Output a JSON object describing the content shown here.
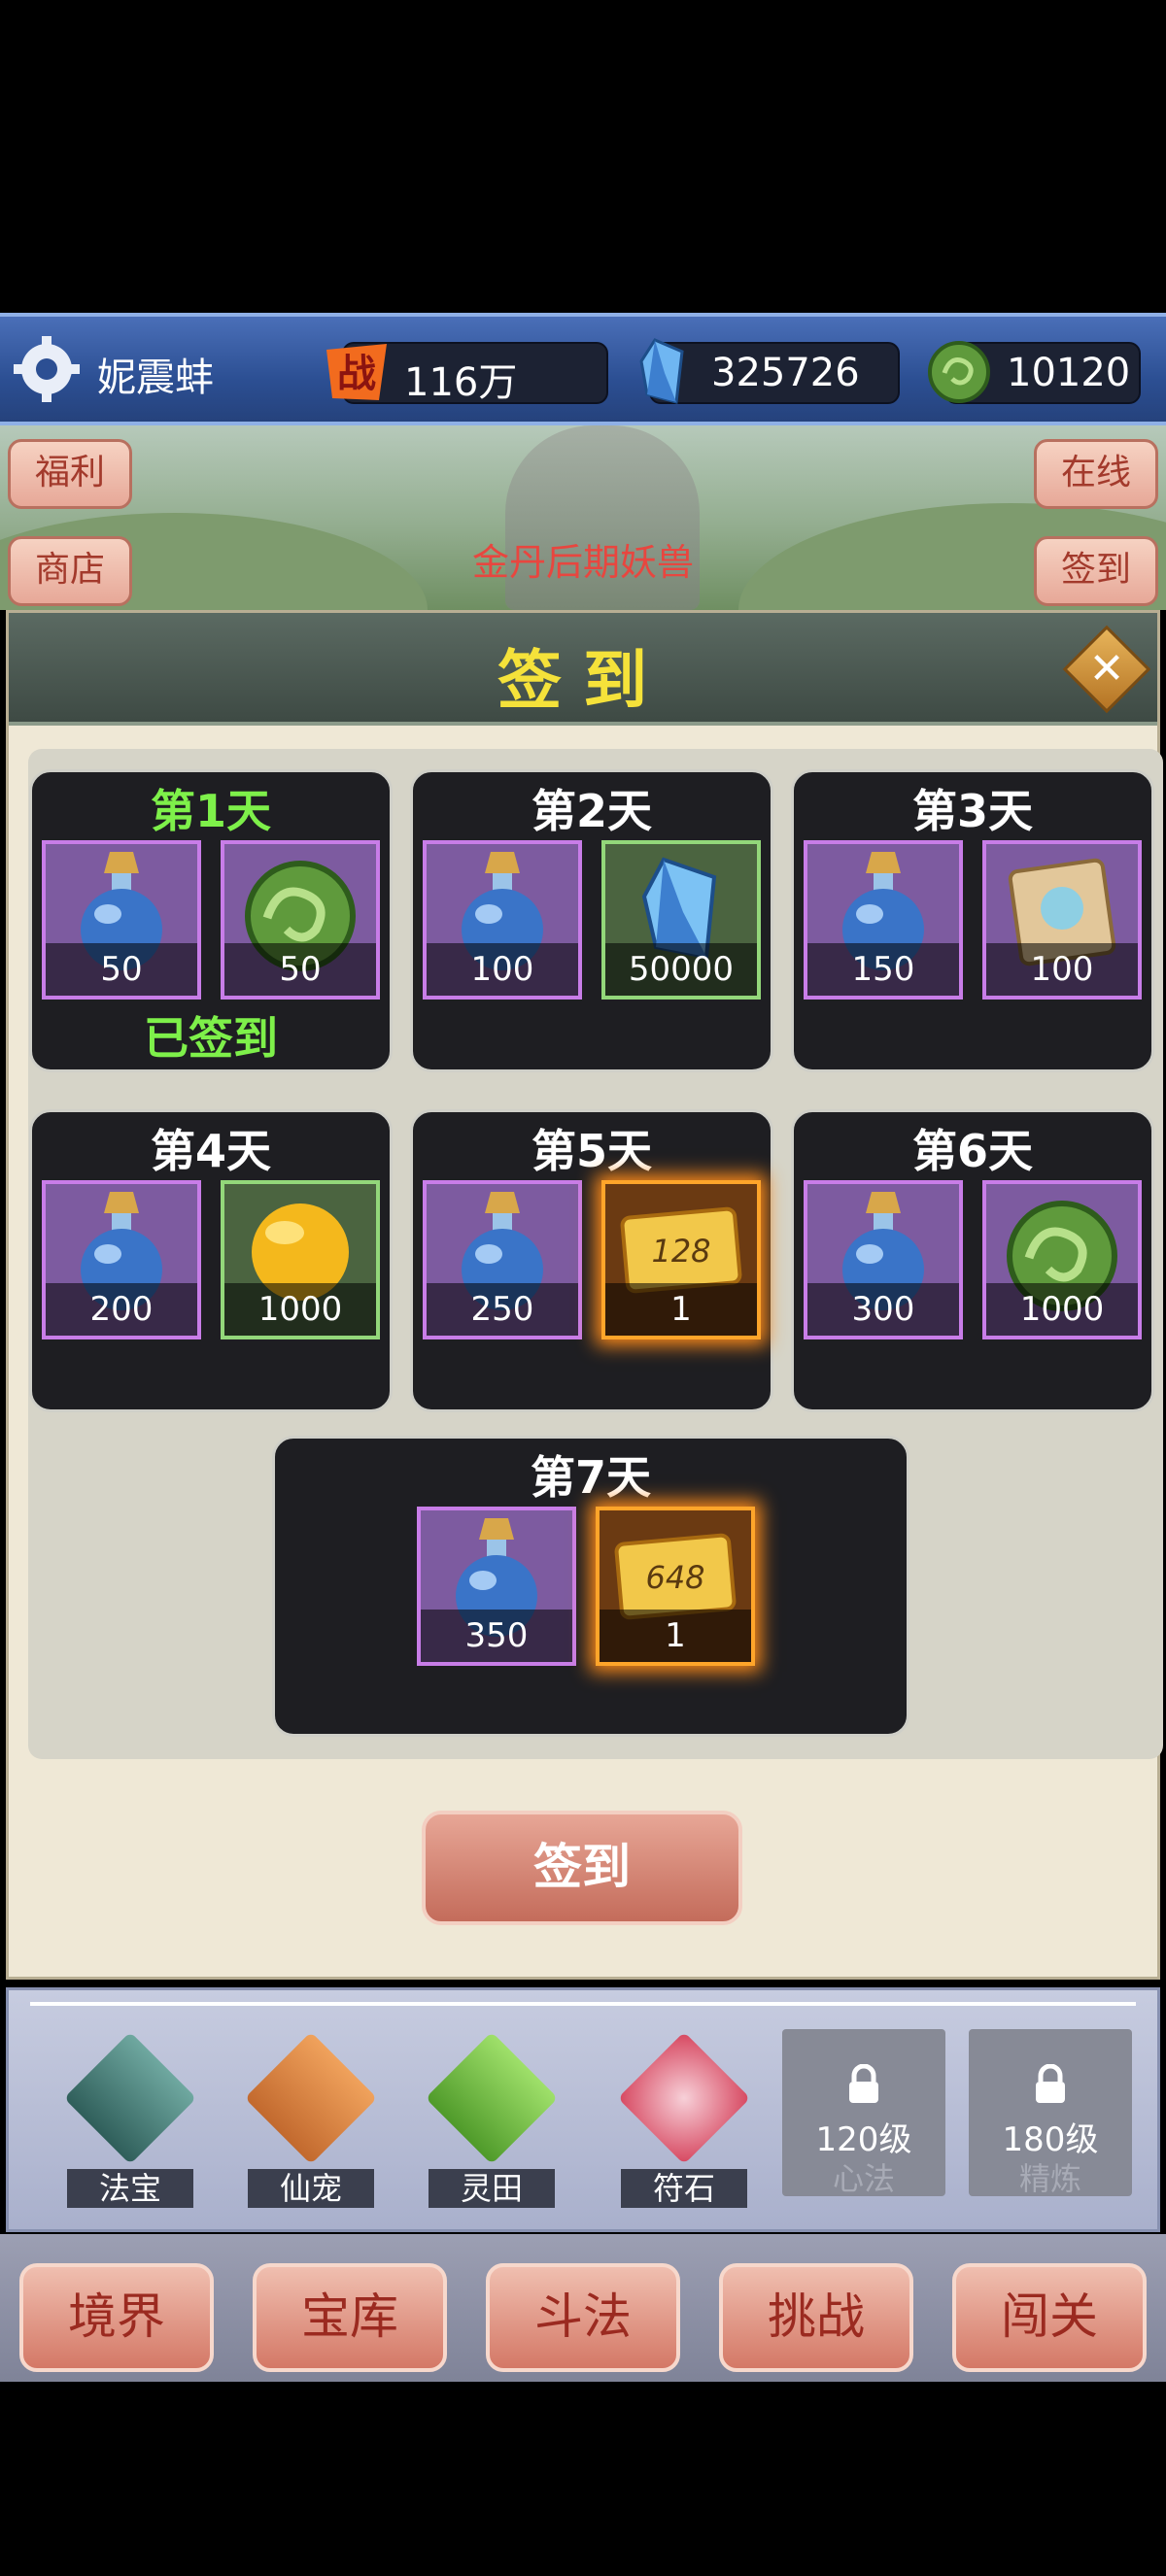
{
  "player": {
    "name": "妮震蚌",
    "gear_icon": "gear-icon"
  },
  "resources": [
    {
      "icon": "battle-power-icon",
      "icon_text": "战",
      "value": "116万"
    },
    {
      "icon": "crystal-icon",
      "value": "325726"
    },
    {
      "icon": "jade-coin-icon",
      "value": "10120"
    }
  ],
  "side_buttons": {
    "left": [
      "福利",
      "商店"
    ],
    "right": [
      "在线",
      "签到"
    ]
  },
  "scene_label": "金丹后期妖兽",
  "panel": {
    "title": "签到",
    "close_icon": "close-icon",
    "days": [
      {
        "title": "第1天",
        "status": "已签到",
        "items": [
          {
            "icon": "potion-icon",
            "count": "50"
          },
          {
            "icon": "jade-coin-icon",
            "count": "50"
          }
        ]
      },
      {
        "title": "第2天",
        "items": [
          {
            "icon": "potion-icon",
            "count": "100"
          },
          {
            "icon": "crystal-icon",
            "count": "50000"
          }
        ]
      },
      {
        "title": "第3天",
        "items": [
          {
            "icon": "potion-icon",
            "count": "150"
          },
          {
            "icon": "scroll-icon",
            "count": "100"
          }
        ]
      },
      {
        "title": "第4天",
        "items": [
          {
            "icon": "potion-icon",
            "count": "200"
          },
          {
            "icon": "gold-orb-icon",
            "count": "1000"
          }
        ]
      },
      {
        "title": "第5天",
        "items": [
          {
            "icon": "potion-icon",
            "count": "250"
          },
          {
            "icon": "gold-ticket-icon",
            "ticket_text": "128",
            "count": "1"
          }
        ]
      },
      {
        "title": "第6天",
        "items": [
          {
            "icon": "potion-icon",
            "count": "300"
          },
          {
            "icon": "jade-coin-icon",
            "count": "1000"
          }
        ]
      },
      {
        "title": "第7天",
        "items": [
          {
            "icon": "potion-icon",
            "count": "350"
          },
          {
            "icon": "gold-ticket-icon",
            "ticket_text": "648",
            "count": "1"
          }
        ]
      }
    ],
    "sign_button": "签到"
  },
  "features": [
    {
      "label": "法宝",
      "icon": "magic-treasure-icon"
    },
    {
      "label": "仙宠",
      "icon": "fox-pet-icon"
    },
    {
      "label": "灵田",
      "icon": "spirit-field-icon"
    },
    {
      "label": "符石",
      "icon": "rune-stone-icon"
    },
    {
      "label": "心法",
      "locked_level": "120级",
      "icon": "lock-icon"
    },
    {
      "label": "精炼",
      "locked_level": "180级",
      "icon": "lock-icon"
    }
  ],
  "nav": [
    "境界",
    "宝库",
    "斗法",
    "挑战",
    "闯关"
  ]
}
